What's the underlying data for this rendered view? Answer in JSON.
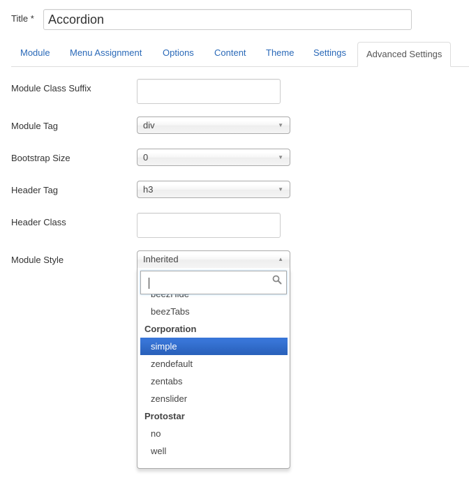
{
  "title_field": {
    "label": "Title *",
    "value": "Accordion"
  },
  "tabs": [
    {
      "label": "Module",
      "active": false
    },
    {
      "label": "Menu Assignment",
      "active": false
    },
    {
      "label": "Options",
      "active": false
    },
    {
      "label": "Content",
      "active": false
    },
    {
      "label": "Theme",
      "active": false
    },
    {
      "label": "Settings",
      "active": false
    },
    {
      "label": "Advanced Settings",
      "active": true
    }
  ],
  "form": {
    "module_class_suffix": {
      "label": "Module Class Suffix",
      "value": ""
    },
    "module_tag": {
      "label": "Module Tag",
      "value": "div",
      "icon": "chevron-down-icon"
    },
    "bootstrap_size": {
      "label": "Bootstrap Size",
      "value": "0",
      "icon": "chevron-down-icon"
    },
    "header_tag": {
      "label": "Header Tag",
      "value": "h3",
      "icon": "chevron-down-icon"
    },
    "header_class": {
      "label": "Header Class",
      "value": ""
    },
    "module_style": {
      "label": "Module Style",
      "value": "Inherited",
      "icon": "chevron-up-icon"
    }
  },
  "dropdown": {
    "search_value": "",
    "search_icon": "search-icon",
    "options": [
      {
        "label": "beezHide",
        "type": "option"
      },
      {
        "label": "beezTabs",
        "type": "option"
      },
      {
        "label": "Corporation",
        "type": "group"
      },
      {
        "label": "simple",
        "type": "option",
        "highlighted": true
      },
      {
        "label": "zendefault",
        "type": "option"
      },
      {
        "label": "zentabs",
        "type": "option"
      },
      {
        "label": "zenslider",
        "type": "option"
      },
      {
        "label": "Protostar",
        "type": "group"
      },
      {
        "label": "no",
        "type": "option"
      },
      {
        "label": "well",
        "type": "option"
      }
    ]
  },
  "colors": {
    "tab_link": "#2a69b8",
    "highlight": "#2a62bc"
  }
}
